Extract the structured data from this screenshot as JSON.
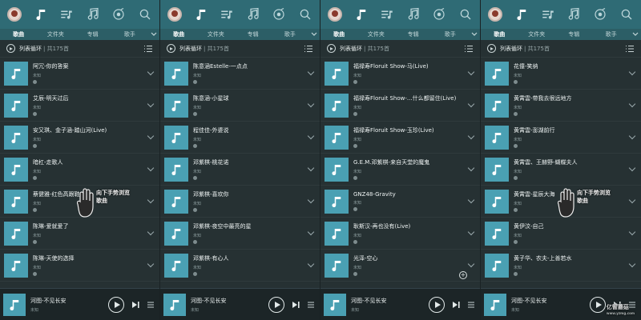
{
  "colors": {
    "topbar": "#2f6b75",
    "tabs": "#2c5e66",
    "background": "#263133",
    "cover": "#4aa0b3",
    "player": "#1c2527"
  },
  "icons": {
    "topbar": [
      "avatar",
      "music-note-icon",
      "playlist-icon",
      "dj-icon",
      "radio-icon",
      "search-icon"
    ],
    "cover": "music-note-icon"
  },
  "tabs": [
    "歌曲",
    "文件夹",
    "专辑",
    "歌手"
  ],
  "mode_bar": {
    "label": "列表循环",
    "count": "| 共175首"
  },
  "artist_unknown": "未知",
  "player": {
    "title": "河图-不见长安",
    "subtitle": "未知"
  },
  "overlay_caption": "向下手势浏览歌曲",
  "watermark": {
    "text": "亿智蘑菇",
    "url": "www.yzmg.com"
  },
  "panels": [
    {
      "songs": [
        "阿冗-你的答案",
        "艾辰-明天过后",
        "安又琪、金子涵-踏山河(Live)",
        "暗杠-走歌人",
        "蔡健雅-红色高跟鞋",
        "陈琳-爱就爱了",
        "陈琳-天使的选择"
      ]
    },
    {
      "songs": [
        "陈意涵Estelle-一点点",
        "陈意涵-小星球",
        "程佳佳-外婆说",
        "邓紫棋-桃花诺",
        "邓紫棋-喜欢你",
        "邓紫棋-夜空中最亮的星",
        "邓紫棋-有心人"
      ]
    },
    {
      "songs": [
        "福禄寿Floruit Show-马(Live)",
        "福禄寿Floruit Show-...什么都留住(Live)",
        "福禄寿Floruit Show-玉珍(Live)",
        "G.E.M.邓紫棋-来自天堂的魔鬼",
        "GNZ48-Gravity",
        "耿斯汉-再也没有(Live)",
        "光泽-空心"
      ]
    },
    {
      "songs": [
        "花僮-笑纳",
        "黄霄雲-带我去很远地方",
        "黄霄雲-澎湖前行",
        "黄霄雲、王赫野-蝴蝶夫人",
        "黄霄雲-星辰大海",
        "黄伊汶-自己",
        "黄子华、农夫-上善若水"
      ]
    }
  ]
}
